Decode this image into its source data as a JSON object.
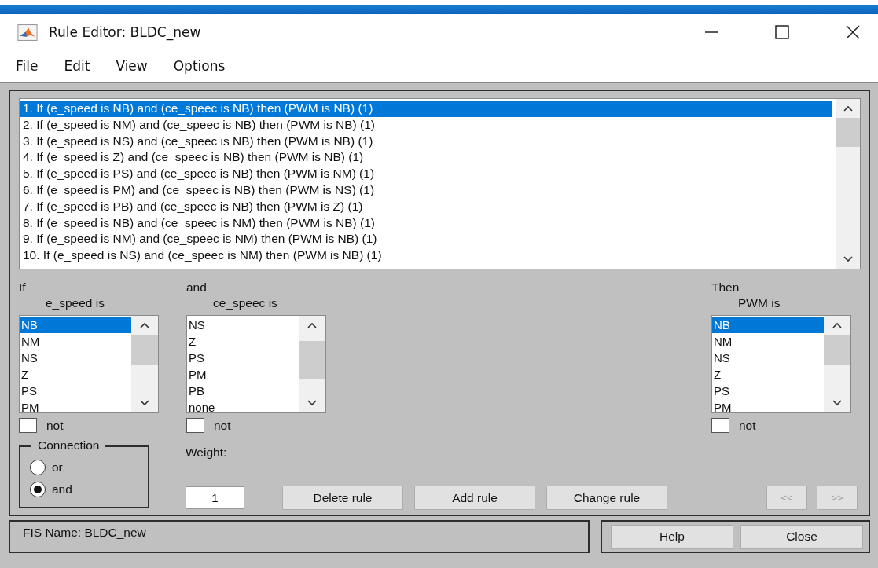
{
  "window": {
    "title": "Rule Editor: BLDC_new"
  },
  "menu": [
    "File",
    "Edit",
    "View",
    "Options"
  ],
  "rules": [
    {
      "text": "1. If (e_speed is NB) and (ce_speec is NB) then (PWM is NB) (1)",
      "selected": true
    },
    {
      "text": "2. If (e_speed is NM) and (ce_speec is NB) then (PWM is NB) (1)",
      "selected": false
    },
    {
      "text": "3. If (e_speed is NS) and (ce_speec is NB) then (PWM is NB) (1)",
      "selected": false
    },
    {
      "text": "4. If (e_speed is Z) and (ce_speec is NB) then (PWM is NB) (1)",
      "selected": false
    },
    {
      "text": "5. If (e_speed is PS) and (ce_speec is NB) then (PWM is NM) (1)",
      "selected": false
    },
    {
      "text": "6. If (e_speed is PM) and (ce_speec is NB) then (PWM is NS) (1)",
      "selected": false
    },
    {
      "text": "7. If (e_speed is PB) and (ce_speec is NB) then (PWM is Z) (1)",
      "selected": false
    },
    {
      "text": "8. If (e_speed is NB) and (ce_speec is NM) then (PWM is NB) (1)",
      "selected": false
    },
    {
      "text": "9. If (e_speed is NM) and (ce_speec is NM) then (PWM is NB) (1)",
      "selected": false
    },
    {
      "text": "10. If (e_speed is NS) and (ce_speec is NM) then (PWM is NB) (1)",
      "selected": false
    }
  ],
  "variables": [
    {
      "heading": "If",
      "variable": "e_speed is",
      "not_label": "not",
      "not_checked": false,
      "options": [
        {
          "label": "NB",
          "selected": true
        },
        {
          "label": "NM",
          "selected": false
        },
        {
          "label": "NS",
          "selected": false
        },
        {
          "label": "Z",
          "selected": false
        },
        {
          "label": "PS",
          "selected": false
        },
        {
          "label": "PM",
          "selected": false
        }
      ]
    },
    {
      "heading": "and",
      "variable": "ce_speec is",
      "not_label": "not",
      "not_checked": false,
      "options": [
        {
          "label": "NS",
          "selected": false
        },
        {
          "label": "Z",
          "selected": false
        },
        {
          "label": "PS",
          "selected": false
        },
        {
          "label": "PM",
          "selected": false
        },
        {
          "label": "PB",
          "selected": false
        },
        {
          "label": "none",
          "selected": false
        }
      ]
    },
    {
      "heading": "Then",
      "variable": "PWM is",
      "not_label": "not",
      "not_checked": false,
      "options": [
        {
          "label": "NB",
          "selected": true
        },
        {
          "label": "NM",
          "selected": false
        },
        {
          "label": "NS",
          "selected": false
        },
        {
          "label": "Z",
          "selected": false
        },
        {
          "label": "PS",
          "selected": false
        },
        {
          "label": "PM",
          "selected": false
        }
      ]
    }
  ],
  "connection": {
    "title": "Connection",
    "options": [
      {
        "label": "or",
        "selected": false
      },
      {
        "label": "and",
        "selected": true
      }
    ]
  },
  "weight": {
    "label": "Weight:",
    "value": "1"
  },
  "buttons": [
    {
      "label": "Delete rule",
      "disabled": false
    },
    {
      "label": "Add rule",
      "disabled": false
    },
    {
      "label": "Change rule",
      "disabled": false
    }
  ],
  "nav_buttons": [
    {
      "label": "<<",
      "disabled": true
    },
    {
      "label": ">>",
      "disabled": true
    }
  ],
  "status": "FIS Name: BLDC_new",
  "footer_buttons": [
    {
      "label": "Help",
      "disabled": false
    },
    {
      "label": "Close",
      "disabled": false
    }
  ]
}
